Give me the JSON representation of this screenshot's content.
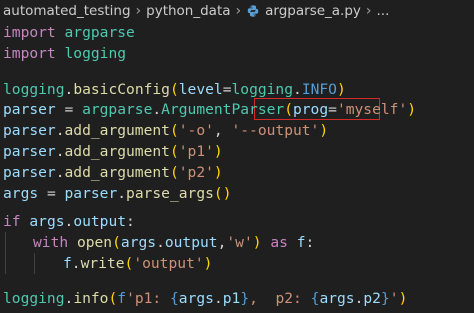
{
  "breadcrumb": {
    "folder1": "automated_testing",
    "folder2": "python_data",
    "file": "argparse_a.py",
    "ellipsis": "..."
  },
  "code": {
    "l1": {
      "a": "import",
      "b": " ",
      "c": "argparse"
    },
    "l2": {
      "a": "import",
      "b": " ",
      "c": "logging"
    },
    "l4": {
      "a": "logging",
      "b": ".",
      "c": "basicConfig",
      "d": "(",
      "e": "level",
      "f": "=",
      "g": "logging",
      "h": ".",
      "i": "INFO",
      "j": ")"
    },
    "l5": {
      "a": "parser",
      "b": " = ",
      "c": "argparse",
      "d": ".",
      "e": "ArgumentParser",
      "f": "(",
      "g": "prog",
      "h": "=",
      "i": "'myself'",
      "j": ")"
    },
    "l6": {
      "a": "parser",
      "b": ".",
      "c": "add_argument",
      "d": "(",
      "e": "'-o'",
      "f": ", ",
      "g": "'--output'",
      "h": ")"
    },
    "l7": {
      "a": "parser",
      "b": ".",
      "c": "add_argument",
      "d": "(",
      "e": "'p1'",
      "f": ")"
    },
    "l8": {
      "a": "parser",
      "b": ".",
      "c": "add_argument",
      "d": "(",
      "e": "'p2'",
      "f": ")"
    },
    "l9": {
      "a": "args",
      "b": " = ",
      "c": "parser",
      "d": ".",
      "e": "parse_args",
      "f": "()"
    },
    "l11": {
      "a": "if",
      "b": " ",
      "c": "args",
      "d": ".",
      "e": "output",
      "f": ":"
    },
    "l12": {
      "a": "with",
      "b": " ",
      "c": "open",
      "d": "(",
      "e": "args",
      "f": ".",
      "g": "output",
      "h": ",",
      "i": "'w'",
      "j": ")",
      "k": " ",
      "l": "as",
      "m": " ",
      "n": "f",
      "o": ":"
    },
    "l13": {
      "a": "f",
      "b": ".",
      "c": "write",
      "d": "(",
      "e": "'output'",
      "f": ")"
    },
    "l15": {
      "a": "logging",
      "b": ".",
      "c": "info",
      "d": "(",
      "e": "f",
      "f": "'p1: ",
      "g": "{",
      "h": "args",
      "i": ".",
      "j": "p1",
      "k": "}",
      "l": ",  p2: ",
      "m": "{",
      "n": "args",
      "o": ".",
      "p": "p2",
      "q": "}",
      "r": "'",
      "s": ")"
    }
  }
}
